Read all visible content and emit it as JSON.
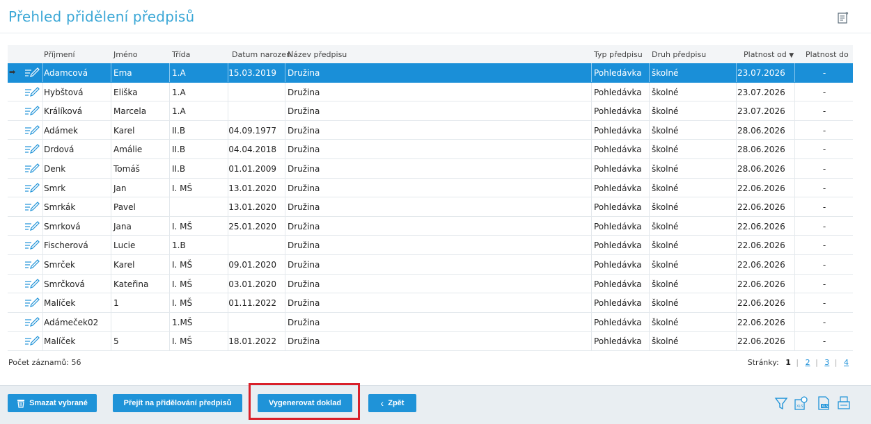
{
  "header": {
    "title": "Přehled přidělení předpisů",
    "help_icon": "help-edit-icon"
  },
  "table": {
    "columns": {
      "prijmeni": "Příjmení",
      "jmeno": "Jméno",
      "trida": "Třída",
      "datum": "Datum narození",
      "nazev": "Název předpisu",
      "typ": "Typ předpisu",
      "druh": "Druh předpisu",
      "od": "Platnost od",
      "do": "Platnost do"
    },
    "rows": [
      {
        "prijmeni": "Adamcová",
        "jmeno": "Ema",
        "trida": "1.A",
        "datum": "15.03.2019",
        "nazev": "Družina",
        "typ": "Pohledávka",
        "druh": "školné",
        "od": "23.07.2026",
        "do": "-"
      },
      {
        "prijmeni": "Hybštová",
        "jmeno": "Eliška",
        "trida": "1.A",
        "datum": "",
        "nazev": "Družina",
        "typ": "Pohledávka",
        "druh": "školné",
        "od": "23.07.2026",
        "do": "-"
      },
      {
        "prijmeni": "Králíková",
        "jmeno": "Marcela",
        "trida": "1.A",
        "datum": "",
        "nazev": "Družina",
        "typ": "Pohledávka",
        "druh": "školné",
        "od": "23.07.2026",
        "do": "-"
      },
      {
        "prijmeni": "Adámek",
        "jmeno": "Karel",
        "trida": "II.B",
        "datum": "04.09.1977",
        "nazev": "Družina",
        "typ": "Pohledávka",
        "druh": "školné",
        "od": "28.06.2026",
        "do": "-"
      },
      {
        "prijmeni": "Drdová",
        "jmeno": "Amálie",
        "trida": "II.B",
        "datum": "04.04.2018",
        "nazev": "Družina",
        "typ": "Pohledávka",
        "druh": "školné",
        "od": "28.06.2026",
        "do": "-"
      },
      {
        "prijmeni": "Denk",
        "jmeno": "Tomáš",
        "trida": "II.B",
        "datum": "01.01.2009",
        "nazev": "Družina",
        "typ": "Pohledávka",
        "druh": "školné",
        "od": "28.06.2026",
        "do": "-"
      },
      {
        "prijmeni": "Smrk",
        "jmeno": "Jan",
        "trida": "I. MŠ",
        "datum": "13.01.2020",
        "nazev": "Družina",
        "typ": "Pohledávka",
        "druh": "školné",
        "od": "22.06.2026",
        "do": "-"
      },
      {
        "prijmeni": "Smrkák",
        "jmeno": "Pavel",
        "trida": "",
        "datum": "13.01.2020",
        "nazev": "Družina",
        "typ": "Pohledávka",
        "druh": "školné",
        "od": "22.06.2026",
        "do": "-"
      },
      {
        "prijmeni": "Smrková",
        "jmeno": "Jana",
        "trida": "I. MŠ",
        "datum": "25.01.2020",
        "nazev": "Družina",
        "typ": "Pohledávka",
        "druh": "školné",
        "od": "22.06.2026",
        "do": "-"
      },
      {
        "prijmeni": "Fischerová",
        "jmeno": "Lucie",
        "trida": "1.B",
        "datum": "",
        "nazev": "Družina",
        "typ": "Pohledávka",
        "druh": "školné",
        "od": "22.06.2026",
        "do": "-"
      },
      {
        "prijmeni": "Smrček",
        "jmeno": "Karel",
        "trida": "I. MŠ",
        "datum": "09.01.2020",
        "nazev": "Družina",
        "typ": "Pohledávka",
        "druh": "školné",
        "od": "22.06.2026",
        "do": "-"
      },
      {
        "prijmeni": "Smrčková",
        "jmeno": "Kateřina",
        "trida": "I. MŠ",
        "datum": "03.01.2020",
        "nazev": "Družina",
        "typ": "Pohledávka",
        "druh": "školné",
        "od": "22.06.2026",
        "do": "-"
      },
      {
        "prijmeni": "Malíček",
        "jmeno": "1",
        "trida": "I. MŠ",
        "datum": "01.11.2022",
        "nazev": "Družina",
        "typ": "Pohledávka",
        "druh": "školné",
        "od": "22.06.2026",
        "do": "-"
      },
      {
        "prijmeni": "Adámeček02",
        "jmeno": "",
        "trida": "1.MŠ",
        "datum": "",
        "nazev": "Družina",
        "typ": "Pohledávka",
        "druh": "školné",
        "od": "22.06.2026",
        "do": "-"
      },
      {
        "prijmeni": "Malíček",
        "jmeno": "5",
        "trida": "I. MŠ",
        "datum": "18.01.2022",
        "nazev": "Družina",
        "typ": "Pohledávka",
        "druh": "školné",
        "od": "22.06.2026",
        "do": "-"
      }
    ],
    "selected_row": 0
  },
  "footer": {
    "record_count": "Počet záznamů: 56",
    "pages_label": "Stránky:",
    "pages": [
      "1",
      "2",
      "3",
      "4"
    ],
    "current_page": "1"
  },
  "toolbar": {
    "delete_label": "Smazat vybrané",
    "goto_label": "Přejít na přidělování předpisů",
    "generate_label": "Vygenerovat doklad",
    "back_label": "Zpět"
  },
  "colors": {
    "accent": "#1f93d8",
    "title": "#3aa7d6",
    "selected_row": "#1a8fd8",
    "highlight": "#d9202a"
  }
}
